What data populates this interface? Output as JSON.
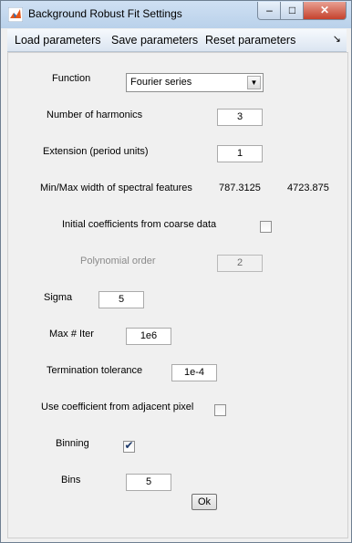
{
  "window": {
    "title": "Background Robust Fit Settings"
  },
  "menu": {
    "items": [
      "Load parameters",
      "Save parameters",
      "Reset parameters"
    ]
  },
  "form": {
    "function": {
      "label": "Function",
      "value": "Fourier series"
    },
    "harmonics": {
      "label": "Number of harmonics",
      "value": "3"
    },
    "extension": {
      "label": "Extension (period units)",
      "value": "1"
    },
    "spectral": {
      "label": "Min/Max width of spectral features",
      "min": "787.3125",
      "max": "4723.875"
    },
    "initial_coeff": {
      "label": "Initial coefficients from coarse data",
      "checked": false
    },
    "poly_order": {
      "label": "Polynomial order",
      "value": "2",
      "enabled": false
    },
    "sigma": {
      "label": "Sigma",
      "value": "5"
    },
    "max_iter": {
      "label": "Max # Iter",
      "value": "1e6"
    },
    "tolerance": {
      "label": "Termination tolerance",
      "value": "1e-4"
    },
    "adjacent": {
      "label": "Use coefficient from adjacent pixel",
      "checked": false
    },
    "binning": {
      "label": "Binning",
      "checked": true
    },
    "bins": {
      "label": "Bins",
      "value": "5"
    },
    "ok_label": "Ok"
  }
}
